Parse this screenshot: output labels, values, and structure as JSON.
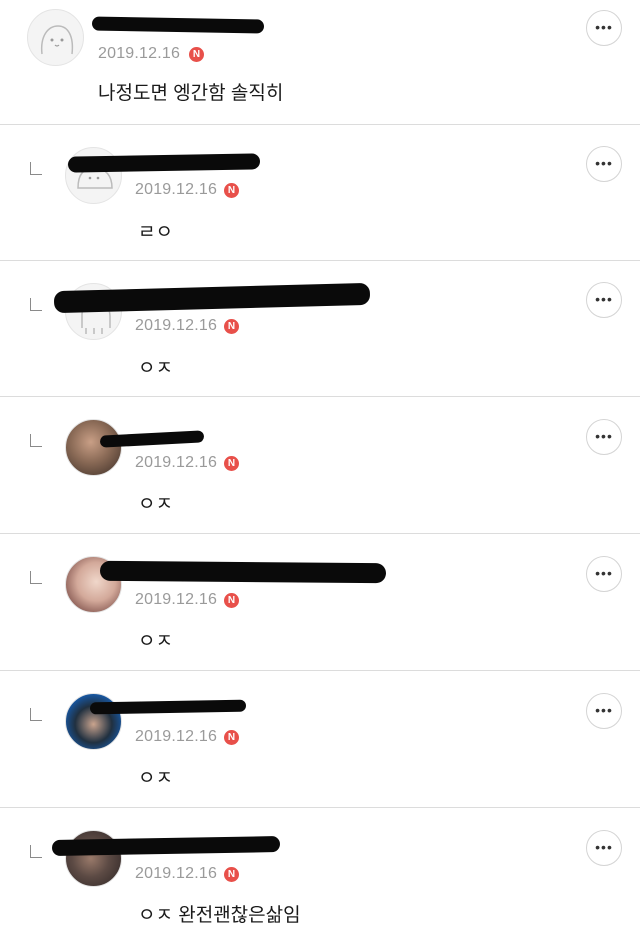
{
  "comments": [
    {
      "username": "",
      "date": "2019.12.16",
      "badge": "N",
      "text": "나정도면 엥간함 솔직히",
      "more_icon": "•••",
      "avatar": "default-character"
    },
    {
      "username": "",
      "date": "2019.12.16",
      "badge": "N",
      "text": "ㄹㅇ",
      "more_icon": "•••",
      "avatar": "default-character"
    },
    {
      "username": "",
      "date": "2019.12.16",
      "badge": "N",
      "text": "ㅇㅈ",
      "more_icon": "•••",
      "avatar": "default-character"
    },
    {
      "username": "",
      "date": "2019.12.16",
      "badge": "N",
      "text": "ㅇㅈ",
      "more_icon": "•••",
      "avatar": "photo"
    },
    {
      "username": "",
      "date": "2019.12.16",
      "badge": "N",
      "text": "ㅇㅈ",
      "more_icon": "•••",
      "avatar": "photo"
    },
    {
      "username": "",
      "date": "2019.12.16",
      "badge": "N",
      "text": "ㅇㅈ",
      "more_icon": "•••",
      "avatar": "photo"
    },
    {
      "username": "",
      "date": "2019.12.16",
      "badge": "N",
      "text": "ㅇㅈ 완전괜찮은삶임",
      "more_icon": "•••",
      "avatar": "photo"
    }
  ],
  "colors": {
    "badge": "#e8504a",
    "date": "#9a9a9a",
    "divider": "#dcdcdc"
  }
}
